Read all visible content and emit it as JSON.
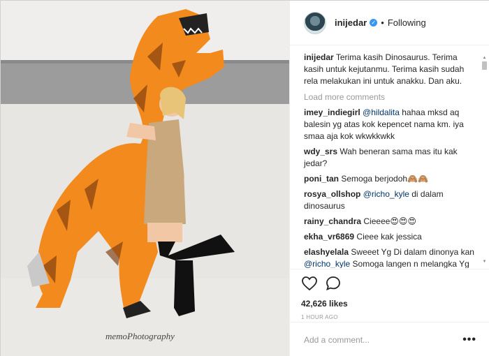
{
  "post": {
    "username": "inijedar",
    "follow_status": "Following",
    "verified_icon": "verified-badge-icon",
    "photo": {
      "description_watermark": "memoPhotography"
    }
  },
  "caption": {
    "user": "inijedar",
    "text": "Terima kasih Dinosaurus. Terima kasih untuk kejutanmu. Terima kasih sudah rela melakukan ini untuk anakku. Dan aku."
  },
  "load_more": "Load more comments",
  "comments": [
    {
      "user": "imey_indiegirl",
      "mention": "@hildalita",
      "text": " hahaa mksd aq balesin yg atas kok kepencet nama km. iya smaa aja kok wkwkkwkk"
    },
    {
      "user": "wdy_srs",
      "mention": "",
      "text": "Wah beneran sama mas itu kak jedar?"
    },
    {
      "user": "poni_tan",
      "mention": "",
      "text": "Semoga berjodoh🙈🙈"
    },
    {
      "user": "rosya_ollshop",
      "mention": "@richo_kyle",
      "text": " di dalam dinosaurus"
    },
    {
      "user": "rainy_chandra",
      "mention": "",
      "text": "Cieeee😍😍😍"
    },
    {
      "user": "ekha_vr6869",
      "mention": "",
      "text": "Cieee kak jessica"
    },
    {
      "user": "elashyelala",
      "mention": "",
      "text": "Sweeet Yg Di dalam dinonya kan ",
      "mention2": "@richo_kyle",
      "text2": " Somoga langen n melangka Yg lebih serius lagi hihihhihi"
    }
  ],
  "likes": "42,626 likes",
  "time": "1 HOUR AGO",
  "add_comment_placeholder": "Add a comment...",
  "more_label": "•••",
  "colors": {
    "link": "#003569",
    "muted": "#999999",
    "verified": "#3897f0",
    "costume_orange": "#f28a1e"
  }
}
